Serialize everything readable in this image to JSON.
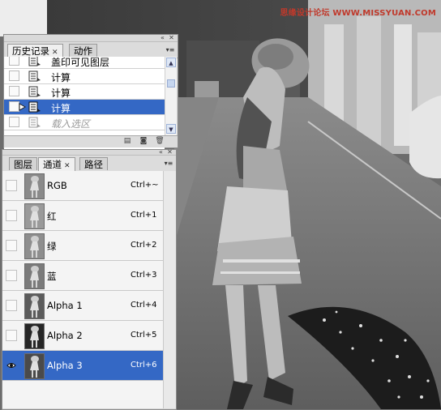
{
  "watermark": "思缘设计论坛 WWW.MISSYUAN.COM",
  "history_panel": {
    "tabs": [
      {
        "label": "历史记录",
        "active": true,
        "closable": true
      },
      {
        "label": "动作",
        "active": false,
        "closable": false
      }
    ],
    "items": [
      {
        "label": "盖印可见图层",
        "state": "normal"
      },
      {
        "label": "计算",
        "state": "normal"
      },
      {
        "label": "计算",
        "state": "normal"
      },
      {
        "label": "计算",
        "state": "selected"
      },
      {
        "label": "载入选区",
        "state": "greyed"
      }
    ]
  },
  "channels_panel": {
    "tabs": [
      {
        "label": "图层",
        "active": false,
        "closable": false
      },
      {
        "label": "通道",
        "active": true,
        "closable": true
      },
      {
        "label": "路径",
        "active": false,
        "closable": false
      }
    ],
    "channels": [
      {
        "name": "RGB",
        "shortcut": "Ctrl+~",
        "visible": false,
        "selected": false,
        "thumb": "#8a8a8a"
      },
      {
        "name": "红",
        "shortcut": "Ctrl+1",
        "visible": false,
        "selected": false,
        "thumb": "#9a9a9a"
      },
      {
        "name": "绿",
        "shortcut": "Ctrl+2",
        "visible": false,
        "selected": false,
        "thumb": "#8e8e8e"
      },
      {
        "name": "蓝",
        "shortcut": "Ctrl+3",
        "visible": false,
        "selected": false,
        "thumb": "#7b7b7b"
      },
      {
        "name": "Alpha 1",
        "shortcut": "Ctrl+4",
        "visible": false,
        "selected": false,
        "thumb": "#5c5c5c"
      },
      {
        "name": "Alpha 2",
        "shortcut": "Ctrl+5",
        "visible": false,
        "selected": false,
        "thumb": "#262626"
      },
      {
        "name": "Alpha 3",
        "shortcut": "Ctrl+6",
        "visible": true,
        "selected": true,
        "thumb": "#4a4a4a"
      }
    ]
  },
  "colors": {
    "selection": "#3468c5",
    "panel_bg": "#e9e9e9"
  },
  "icons": {
    "eye": "eye-icon",
    "history_state": "history-state-icon",
    "panel_menu": "panel-menu-icon",
    "close": "close-icon"
  }
}
